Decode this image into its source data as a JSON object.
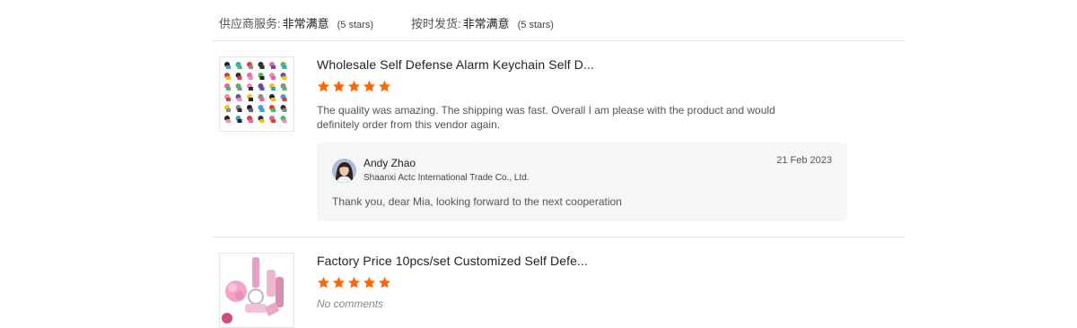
{
  "ratings": [
    {
      "label": "供应商服务:",
      "value": "非常满意",
      "stars": "(5 stars)"
    },
    {
      "label": "按时发货:",
      "value": "非常满意",
      "stars": "(5 stars)"
    }
  ],
  "reviews": [
    {
      "product_title": "Wholesale Self Defense Alarm Keychain Self D...",
      "rating": 5,
      "text": "The quality was amazing. The shipping was fast. Overall I am please with the product and would definitely order from this vendor again.",
      "reply": {
        "name": "Andy Zhao",
        "company": "Shaanxi Actc International Trade Co., Ltd.",
        "date": "21 Feb 2023",
        "text": "Thank you, dear Mia, looking forward to the next cooperation"
      }
    },
    {
      "product_title": "Factory Price 10pcs/set Customized Self Defe...",
      "rating": 5,
      "no_comments": "No comments"
    }
  ],
  "colors": {
    "star": "#ff6a00",
    "divider": "#e2e2e2",
    "reply_bg": "#f5f6f8"
  },
  "icons": {
    "star": "star-icon",
    "avatar": "avatar-image"
  }
}
